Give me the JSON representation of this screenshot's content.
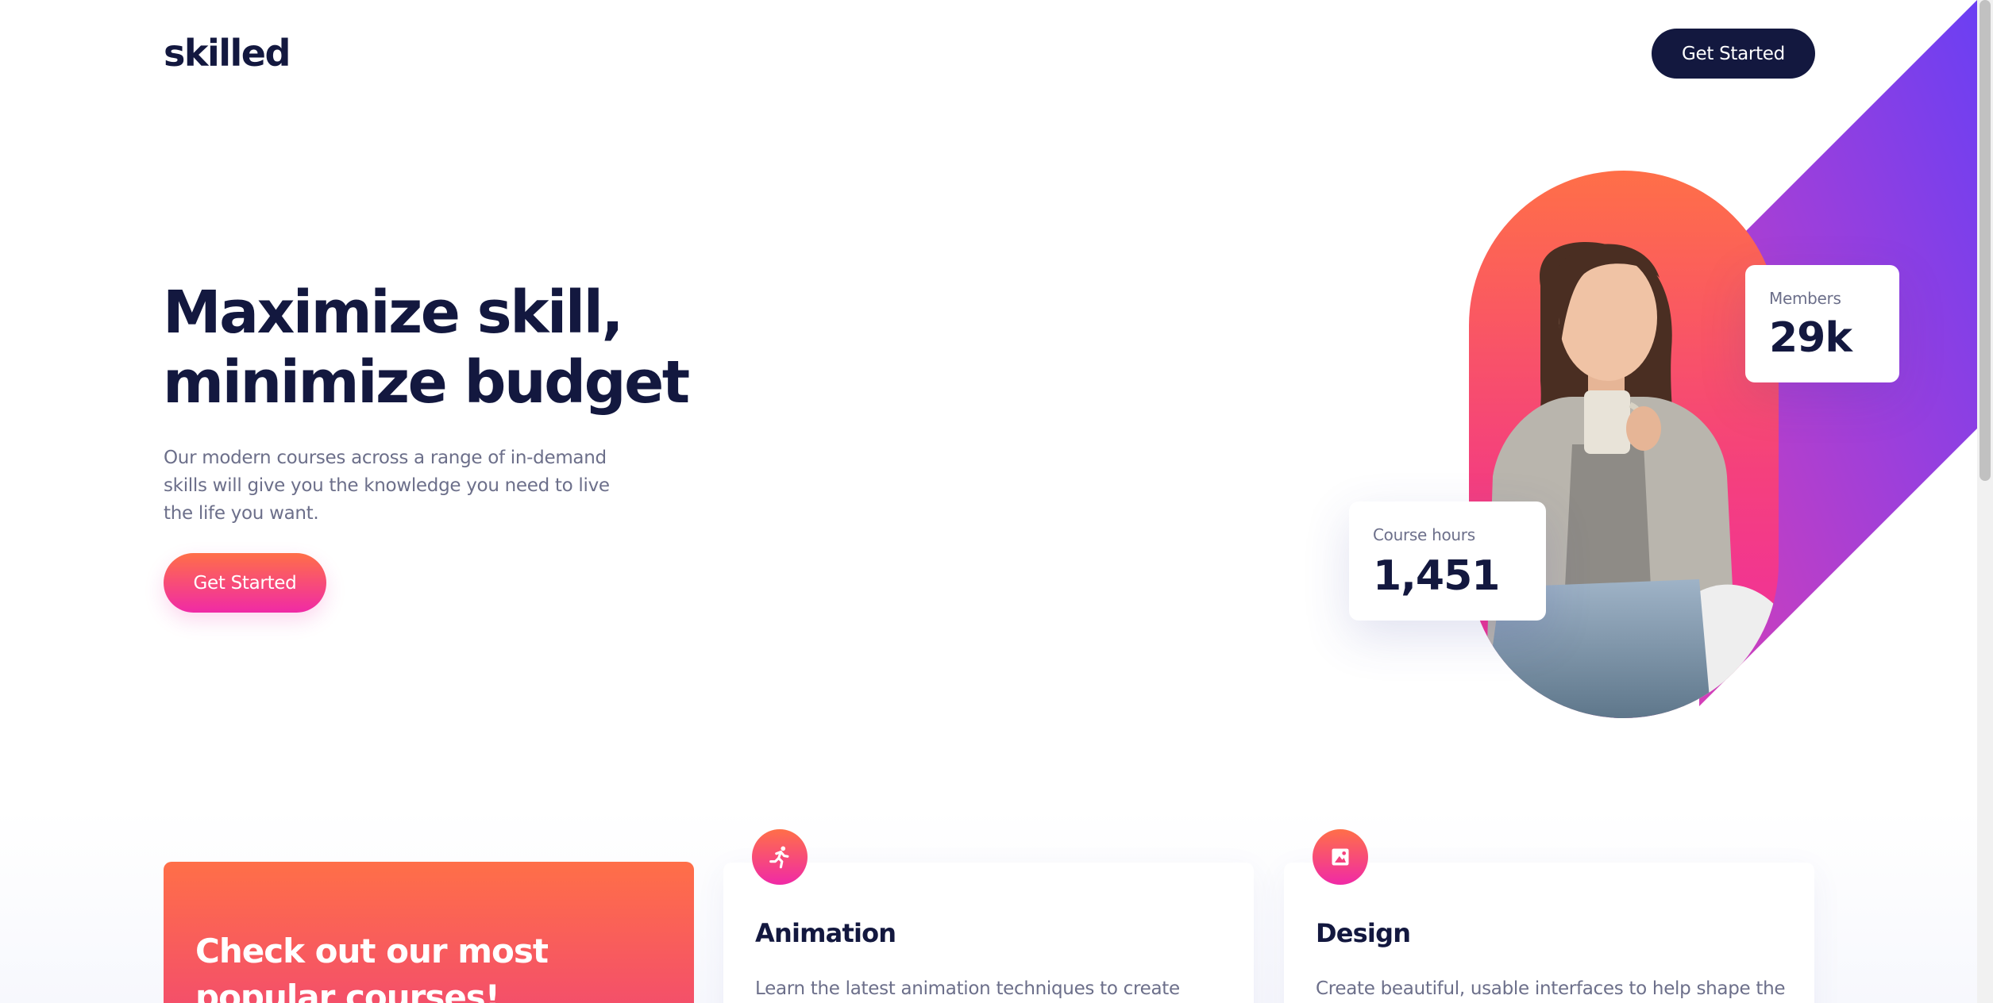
{
  "header": {
    "logo": "skilled",
    "cta_label": "Get Started"
  },
  "hero": {
    "title_line1": "Maximize skill,",
    "title_line2": "minimize budget",
    "description": "Our modern courses across a range of in-demand skills will give you the knowledge you need to live the life you want.",
    "cta_label": "Get Started"
  },
  "stats": {
    "members_label": "Members",
    "members_value": "29k",
    "hours_label": "Course hours",
    "hours_value": "1,451"
  },
  "promo": {
    "title": "Check out our most popular courses!"
  },
  "courses": [
    {
      "title": "Animation",
      "description": "Learn the latest animation techniques to create",
      "icon": "running-person-icon"
    },
    {
      "title": "Design",
      "description": "Create beautiful, usable interfaces to help shape the",
      "icon": "image-icon"
    }
  ],
  "colors": {
    "navy": "#13183f",
    "orange": "#ff6f48",
    "pink": "#f02aa6",
    "purple": "#6b3ff3",
    "text_muted": "#6c6f8a"
  }
}
